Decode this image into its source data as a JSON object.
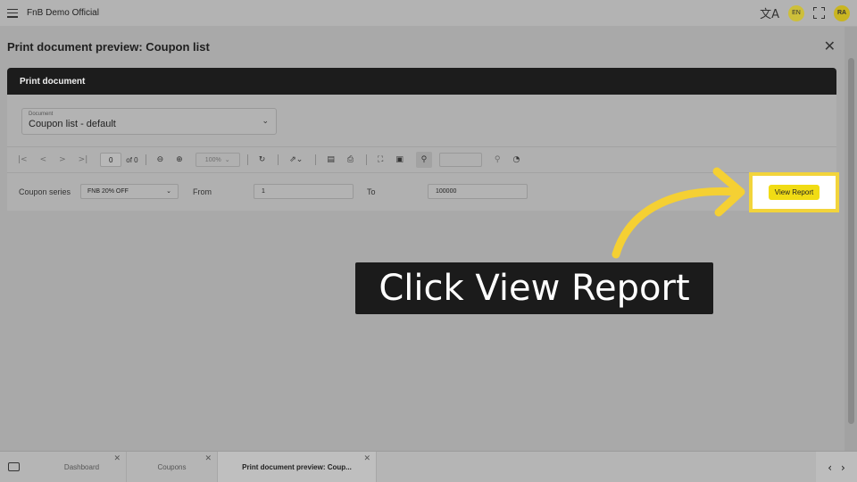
{
  "app": {
    "title": "FnB Demo Official",
    "lang": "EN",
    "user_initials": "RA"
  },
  "page": {
    "title": "Print document preview: Coupon list"
  },
  "panel": {
    "header": "Print document",
    "document_label": "Document",
    "document_value": "Coupon list - default"
  },
  "toolbar": {
    "page_value": "0",
    "of_label": "of 0",
    "zoom_value": "100%"
  },
  "params": {
    "coupon_series_label": "Coupon series",
    "coupon_series_value": "FNB 20% OFF",
    "from_label": "From",
    "from_value": "1",
    "to_label": "To",
    "to_value": "100000",
    "view_report_label": "View Report"
  },
  "callout": {
    "text": "Click View Report"
  },
  "tabs": [
    {
      "label": "Dashboard"
    },
    {
      "label": "Coupons"
    },
    {
      "label": "Print document preview: Coup..."
    }
  ],
  "colors": {
    "highlight": "#f2d43b",
    "button": "#f1dc14",
    "panel_header": "#1c1c1c"
  }
}
